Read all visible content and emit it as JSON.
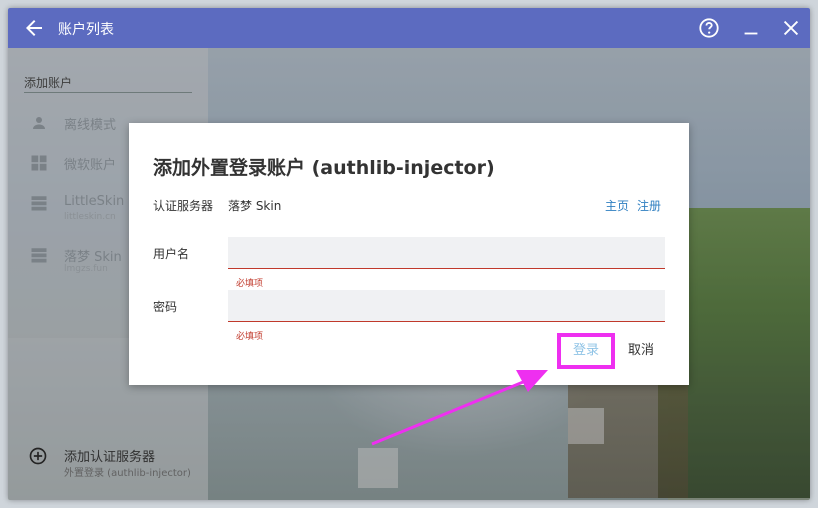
{
  "titlebar": {
    "title": "账户列表",
    "back_icon": "arrow-left-icon",
    "help_icon": "help-circle-icon",
    "min_icon": "minimize-icon",
    "close_icon": "close-icon",
    "bg_color": "#5c6bc0"
  },
  "sidebar": {
    "section_label": "添加账户",
    "items": [
      {
        "label": "离线模式",
        "sub": "",
        "icon": "person-icon"
      },
      {
        "label": "微软账户",
        "sub": "",
        "icon": "windows-icon"
      },
      {
        "label": "LittleSkin",
        "sub": "littleskin.cn",
        "icon": "server-icon"
      },
      {
        "label": "落梦 Skin",
        "sub": "lmgzs.fun",
        "icon": "server-icon"
      }
    ],
    "add_auth": {
      "label": "添加认证服务器",
      "sub": "外置登录 (authlib-injector)",
      "icon": "add-circle-icon"
    }
  },
  "dialog": {
    "title": "添加外置登录账户 (authlib-injector)",
    "server_label": "认证服务器",
    "server_value": "落梦 Skin",
    "link_home": "主页",
    "link_register": "注册",
    "username_label": "用户名",
    "username_value": "",
    "username_error": "必填项",
    "password_label": "密码",
    "password_value": "",
    "password_error": "必填项",
    "login_button": "登录",
    "cancel_button": "取消",
    "link_color": "#2f7fc1",
    "error_color": "#c0392b",
    "highlight_color": "#ee2ff0"
  }
}
